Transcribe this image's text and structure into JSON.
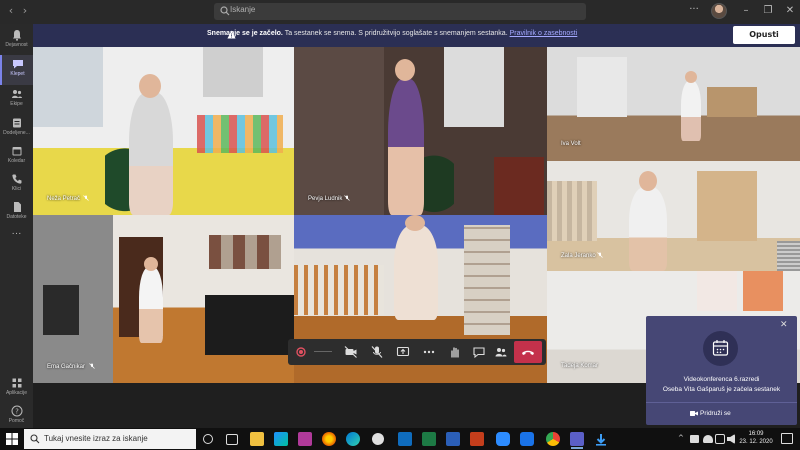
{
  "titlebar": {
    "search_placeholder": "Iskanje",
    "back": "‹",
    "forward": "›",
    "more": "···",
    "minimize": "–",
    "maximize": "❐",
    "close": "✕"
  },
  "rail": {
    "items": [
      {
        "label": "Dejavnost",
        "icon": "bell-icon"
      },
      {
        "label": "Klepet",
        "icon": "chat-icon"
      },
      {
        "label": "Ekipe",
        "icon": "teams-icon"
      },
      {
        "label": "Dodeljene...",
        "icon": "assignments-icon"
      },
      {
        "label": "Koledar",
        "icon": "calendar-icon"
      },
      {
        "label": "Klici",
        "icon": "phone-icon"
      },
      {
        "label": "Datoteke",
        "icon": "files-icon"
      },
      {
        "label": "···",
        "icon": "more-icon"
      },
      {
        "label": "Aplikacije",
        "icon": "apps-icon"
      },
      {
        "label": "Pomoč",
        "icon": "help-icon"
      }
    ]
  },
  "banner": {
    "bold_text": "Snemanje se je začelo.",
    "text": " Ta sestanek se snema. S pridružitvijo soglašate s snemanjem sestanka.",
    "link": "Pravilnik o zasebnosti",
    "leave_button": "Opusti"
  },
  "participants": [
    {
      "name": "Neža Petrač"
    },
    {
      "name": "Pevja Ludnik"
    },
    {
      "name": "Iva Volt"
    },
    {
      "name": "Zala Jeranko"
    },
    {
      "name": "Ema Gačnikar"
    },
    {
      "name": "Tadeja Komar"
    }
  ],
  "notification": {
    "title": "Videokonferenca 6.razredi",
    "subtitle": "Oseba Vita Gašparuš je začela sestanek",
    "join": "Pridruži se",
    "close": "✕"
  },
  "taskbar": {
    "search_placeholder": "Tukaj vnesite izraz za iskanje",
    "time": "16:09",
    "date": "23. 12. 2020"
  },
  "colors": {
    "banner": "#2b2f54",
    "accent": "#7b83eb",
    "hangup": "#c4314b",
    "notification": "#464775"
  }
}
